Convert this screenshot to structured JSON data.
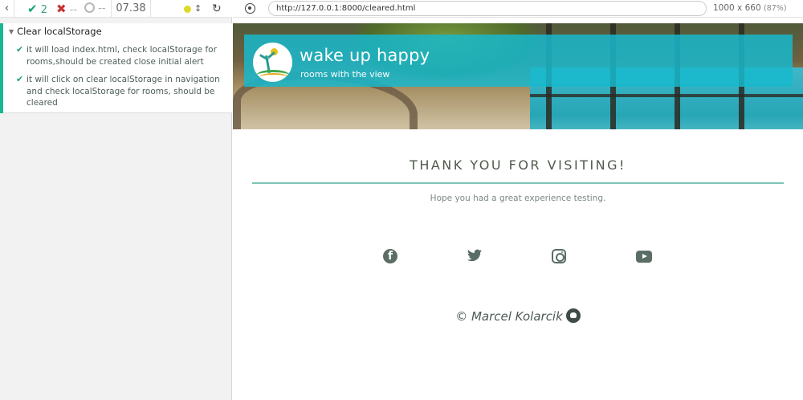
{
  "runner": {
    "back_icon": "chevron-left-icon",
    "stats": {
      "passed": "2",
      "failed": "--",
      "pending": "--"
    },
    "timer": "07.38",
    "arrows_glyph": "↕",
    "reload_glyph": "↻",
    "status_color": "#ded928",
    "suite": {
      "title": "Clear localStorage",
      "accent_color": "#17b890",
      "tests": [
        {
          "label": "it will load index.html, check localStorage for rooms,should be created close initial alert"
        },
        {
          "label": "it will click on clear localStorage in navigation and check localStorage for rooms, should be cleared"
        }
      ]
    }
  },
  "browser": {
    "url": "http://127.0.0.1:8000/cleared.html",
    "viewport_size": "1000 x 660",
    "zoom": "(87%)"
  },
  "site": {
    "brand": {
      "title": "wake up happy",
      "subtitle": "rooms with the view"
    },
    "banner_color": "#18b9cd",
    "heading": "THANK YOU FOR VISITING!",
    "message": "Hope you had a great experience testing.",
    "social_icons": [
      "facebook-icon",
      "twitter-icon",
      "instagram-icon",
      "youtube-icon"
    ],
    "footer": {
      "copyright": "© Marcel Kolarcik",
      "icon": "github-icon"
    }
  }
}
